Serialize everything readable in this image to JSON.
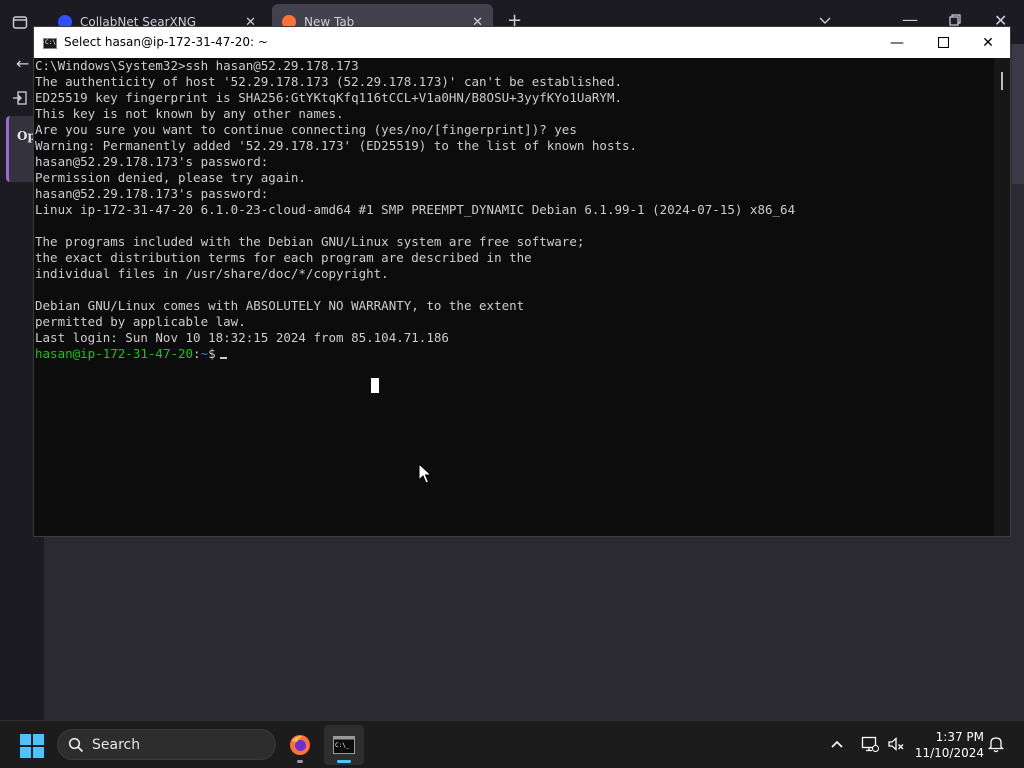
{
  "browser": {
    "tabs": [
      {
        "title": "CollabNet SearXNG"
      },
      {
        "title": "New Tab"
      }
    ],
    "partial_card_text": "Op"
  },
  "terminal": {
    "title": "Select hasan@ip-172-31-47-20: ~",
    "lines": [
      "C:\\Windows\\System32>ssh hasan@52.29.178.173",
      "The authenticity of host '52.29.178.173 (52.29.178.173)' can't be established.",
      "ED25519 key fingerprint is SHA256:GtYKtqKfq116tCCL+V1a0HN/B8OSU+3yyfKYo1UaRYM.",
      "This key is not known by any other names.",
      "Are you sure you want to continue connecting (yes/no/[fingerprint])? yes",
      "Warning: Permanently added '52.29.178.173' (ED25519) to the list of known hosts.",
      "hasan@52.29.178.173's password:",
      "Permission denied, please try again.",
      "hasan@52.29.178.173's password:",
      "Linux ip-172-31-47-20 6.1.0-23-cloud-amd64 #1 SMP PREEMPT_DYNAMIC Debian 6.1.99-1 (2024-07-15) x86_64",
      "",
      "The programs included with the Debian GNU/Linux system are free software;",
      "the exact distribution terms for each program are described in the",
      "individual files in /usr/share/doc/*/copyright.",
      "",
      "Debian GNU/Linux comes with ABSOLUTELY NO WARRANTY, to the extent",
      "permitted by applicable law.",
      "Last login: Sun Nov 10 18:32:15 2024 from 85.104.71.186"
    ],
    "prompt": {
      "user_host": "hasan@ip-172-31-47-20",
      "separator": ":",
      "path": "~",
      "symbol": "$"
    }
  },
  "taskbar": {
    "search_label": "Search",
    "time": "1:37 PM",
    "date": "11/10/2024",
    "apps": [
      "firefox-icon",
      "terminal-icon"
    ]
  },
  "colors": {
    "terminal_bg": "#0c0c0c",
    "terminal_text": "#cccccc",
    "prompt_green": "#16c60c",
    "prompt_blue": "#3b78ff",
    "start_blue": "#4cc2ff"
  }
}
